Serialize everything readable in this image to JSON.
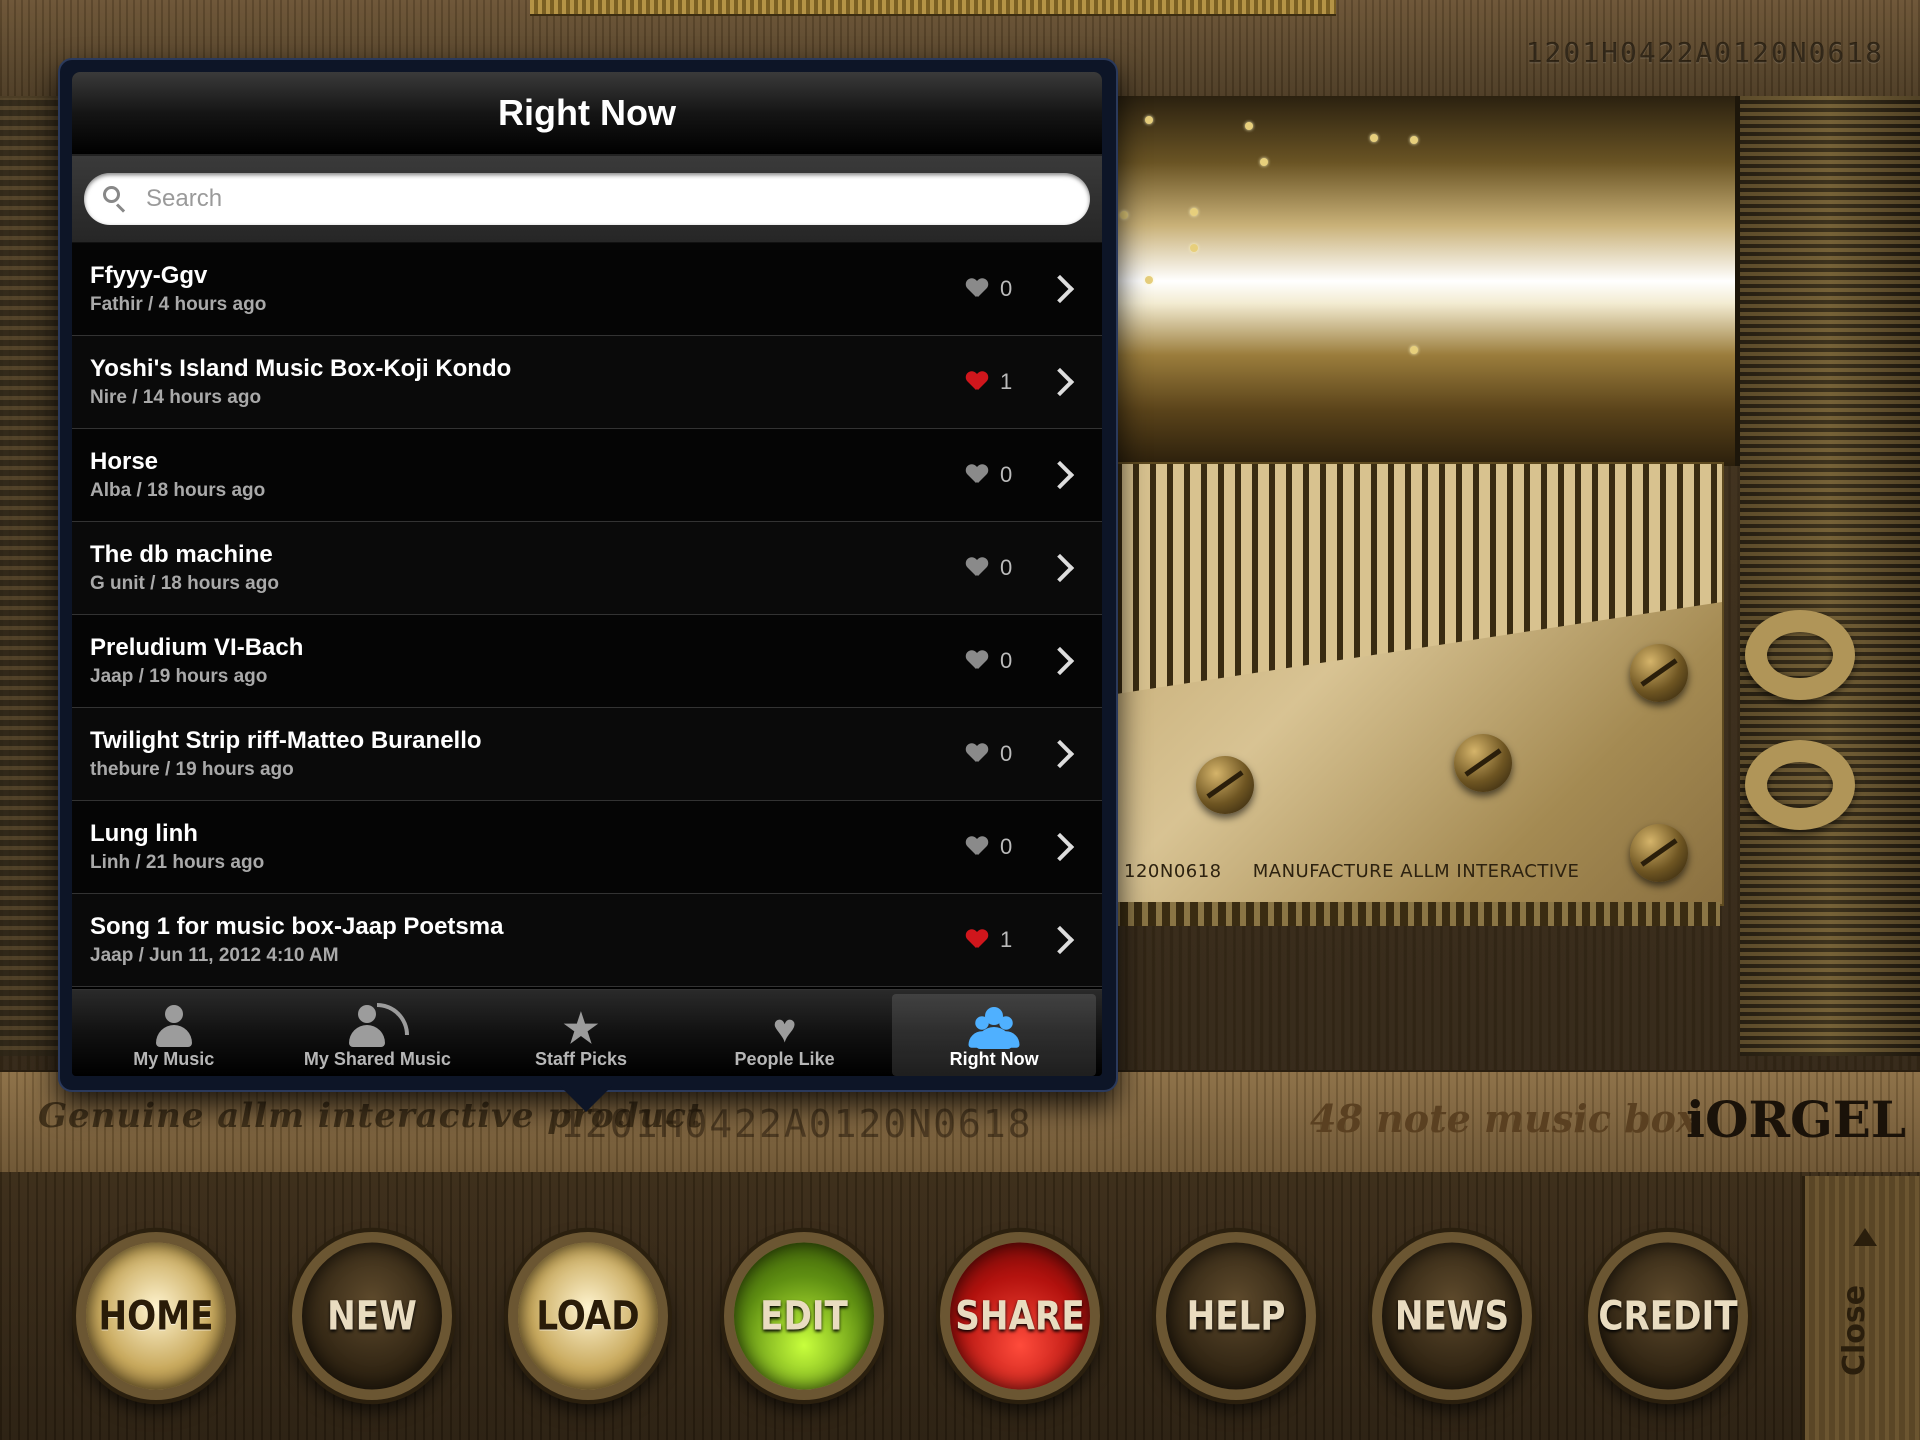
{
  "background": {
    "serial_top": "1201H0422A0120N0618",
    "serial_mid": "1201H0422A0120N0618",
    "genuine_text": "Genuine allm interactive product",
    "note_box_text": "48 note music box",
    "brand": "iORGEL",
    "comb_serial": "120N0618",
    "comb_label": "MANUFACTURE ALLM INTERACTIVE"
  },
  "popover": {
    "title": "Right Now",
    "search": {
      "placeholder": "Search",
      "value": ""
    },
    "items": [
      {
        "title": "Ffyyy-Ggv",
        "subtitle": "Fathir / 4 hours ago",
        "likes": "0",
        "liked": false
      },
      {
        "title": "Yoshi's Island Music Box-Koji Kondo",
        "subtitle": "Nire / 14 hours ago",
        "likes": "1",
        "liked": true
      },
      {
        "title": "Horse",
        "subtitle": "Alba / 18 hours ago",
        "likes": "0",
        "liked": false
      },
      {
        "title": "The db machine",
        "subtitle": "G unit / 18 hours ago",
        "likes": "0",
        "liked": false
      },
      {
        "title": "Preludium VI-Bach",
        "subtitle": "Jaap / 19 hours ago",
        "likes": "0",
        "liked": false
      },
      {
        "title": "Twilight Strip riff-Matteo Buranello",
        "subtitle": "thebure / 19 hours ago",
        "likes": "0",
        "liked": false
      },
      {
        "title": "Lung linh",
        "subtitle": "Linh / 21 hours ago",
        "likes": "0",
        "liked": false
      },
      {
        "title": "Song 1 for music box-Jaap Poetsma",
        "subtitle": "Jaap / Jun 11, 2012 4:10 AM",
        "likes": "1",
        "liked": true
      }
    ],
    "tabs": [
      {
        "label": "My Music",
        "icon": "person-icon",
        "active": false
      },
      {
        "label": "My Shared Music",
        "icon": "person-broadcast-icon",
        "active": false
      },
      {
        "label": "Staff Picks",
        "icon": "star-icon",
        "active": false
      },
      {
        "label": "People Like",
        "icon": "heart-icon",
        "active": false
      },
      {
        "label": "Right Now",
        "icon": "people-icon",
        "active": true
      }
    ]
  },
  "controls": {
    "buttons": [
      "HOME",
      "NEW",
      "LOAD",
      "EDIT",
      "SHARE",
      "HELP",
      "NEWS",
      "CREDIT"
    ],
    "close_label": "Close"
  },
  "colors": {
    "liked_heart": "#d0161c",
    "unliked_heart": "#8a8a8a",
    "active_tab_icon": "#4fb0ff",
    "edit_button": "#7fbf1a",
    "share_button": "#c81410"
  }
}
